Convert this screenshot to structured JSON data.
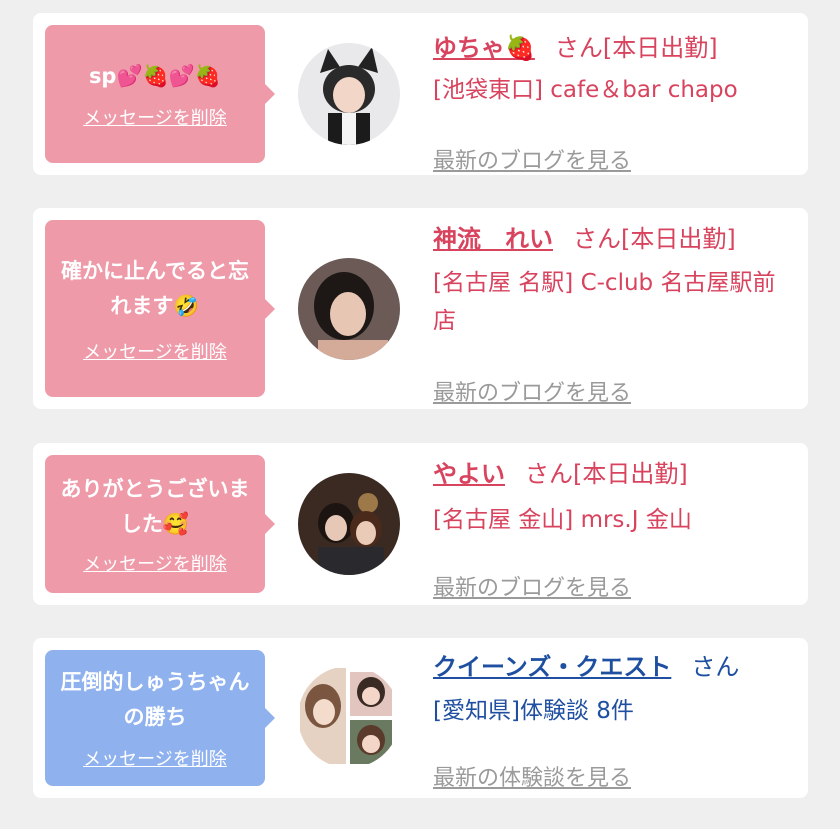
{
  "items": [
    {
      "bubble_text": "sp💕🍓💕🍓",
      "delete_label": "メッセージを削除",
      "name": "ゆちゃ🍓",
      "suffix": "さん[本日出勤]",
      "shop": "[池袋東口] cafe＆bar chapo",
      "blog_link": "最新のブログを見る",
      "theme_color": "#ee9aa9"
    },
    {
      "bubble_text": "確かに止んでると忘れます🤣",
      "delete_label": "メッセージを削除",
      "name": "神流　れい",
      "suffix": "さん[本日出勤]",
      "shop": "[名古屋 名駅] C-club 名古屋駅前店",
      "blog_link": "最新のブログを見る",
      "theme_color": "#ee9aa9"
    },
    {
      "bubble_text": "ありがとうございました🥰",
      "delete_label": "メッセージを削除",
      "name": "やよい",
      "suffix": "さん[本日出勤]",
      "shop": "[名古屋 金山] mrs.J 金山",
      "blog_link": "最新のブログを見る",
      "theme_color": "#ee9aa9"
    },
    {
      "bubble_text": "圧倒的しゅうちゃんの勝ち",
      "delete_label": "メッセージを削除",
      "name": "クイーンズ・クエスト",
      "suffix": "さん",
      "shop": "[愛知県]体験談 8件",
      "blog_link": "最新の体験談を見る",
      "theme_color": "#8fb2ef"
    }
  ]
}
